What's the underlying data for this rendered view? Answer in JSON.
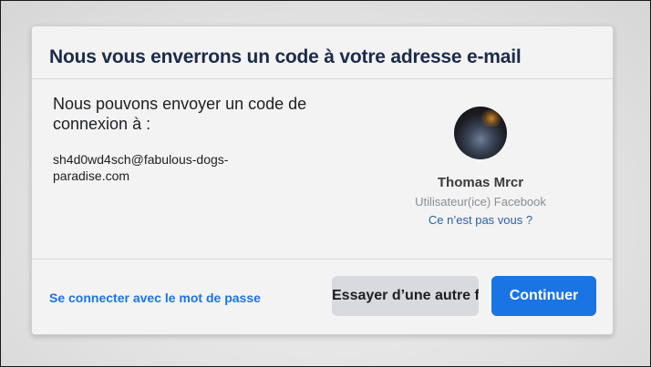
{
  "dialog": {
    "title": "Nous vous enverrons un code à votre adresse e-mail",
    "message": "Nous pouvons envoyer un code de connexion à :",
    "email": "sh4d0wd4sch@fabulous-dogs-paradise.com"
  },
  "profile": {
    "name": "Thomas Mrcr",
    "role": "Utilisateur(ice) Facebook",
    "not_you_link": "Ce n’est pas vous ?"
  },
  "footer": {
    "password_link": "Se connecter avec le mot de passe",
    "try_other_button": "Essayer d’une autre fa",
    "continue_button": "Continuer"
  },
  "colors": {
    "title": "#1c2b4a",
    "primary": "#1b74e4",
    "secondary_button": "#d8dadf",
    "link_profile": "#2d5ea8"
  }
}
